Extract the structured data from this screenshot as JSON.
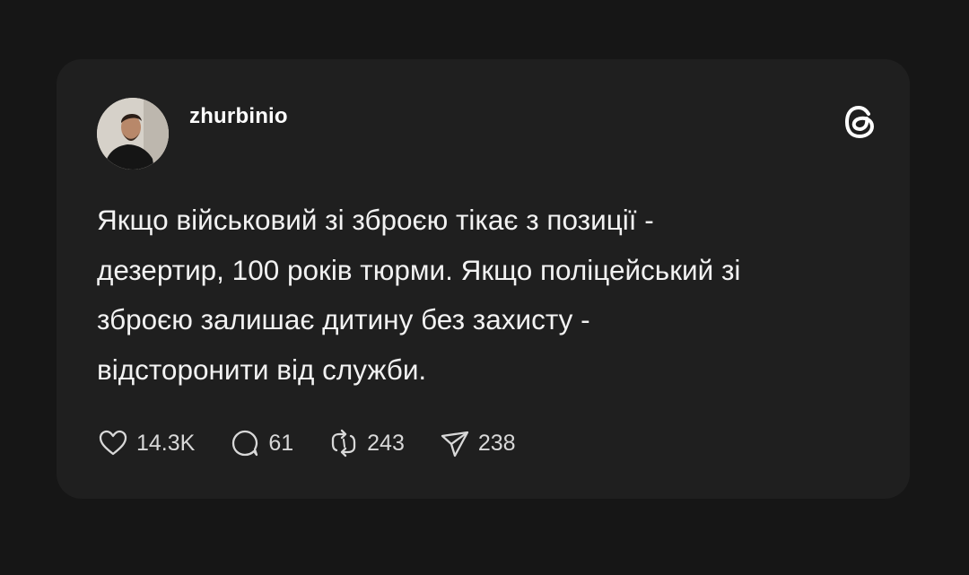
{
  "post": {
    "username": "zhurbinio",
    "text": "Якщо військовий зі зброєю тікає з позиції -\nдезертир, 100 років тюрми. Якщо поліцейський зі\nзброєю залишає дитину без захисту -\nвідсторонити від служби."
  },
  "actions": {
    "likes": "14.3K",
    "comments": "61",
    "reposts": "243",
    "shares": "238"
  },
  "icons": {
    "logo": "threads-logo-icon",
    "like": "heart-icon",
    "comment": "comment-bubble-icon",
    "repost": "repost-arrows-icon",
    "share": "paper-plane-icon"
  },
  "colors": {
    "background": "#161616",
    "card": "#1f1f1f",
    "text": "#f2f2f2",
    "muted": "#d8d8d8"
  }
}
